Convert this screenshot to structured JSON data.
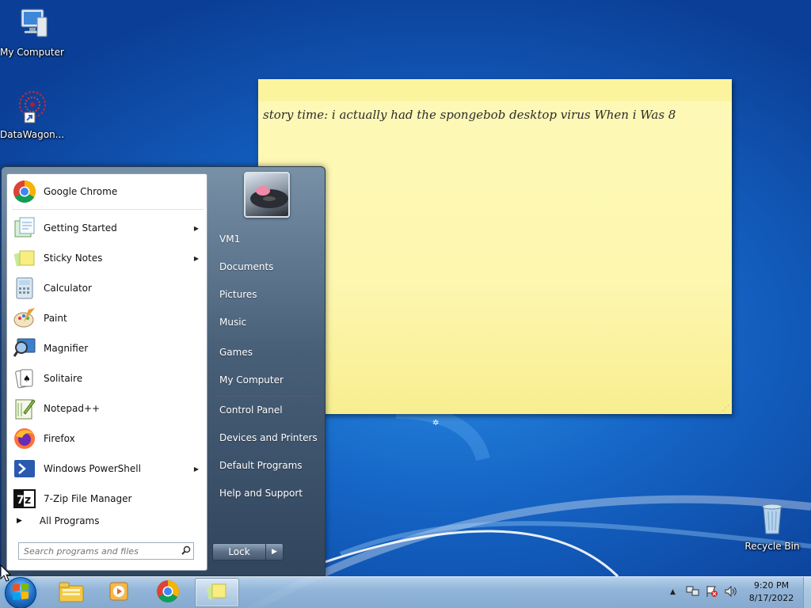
{
  "desktop": {
    "icons": [
      {
        "label": "My Computer",
        "icon": "computer-icon"
      },
      {
        "label": "DataWagon...",
        "icon": "datawagon-shortcut-icon"
      },
      {
        "label": "Recycle Bin",
        "icon": "recycle-bin-icon"
      }
    ]
  },
  "sticky_note": {
    "text": "story time: i actually had the spongebob desktop virus When i Was 8",
    "color": "#fdf8b6"
  },
  "start_menu": {
    "programs": [
      {
        "label": "Google Chrome",
        "icon": "chrome-icon",
        "submenu": false
      },
      {
        "label": "Getting Started",
        "icon": "getting-started-icon",
        "submenu": true
      },
      {
        "label": "Sticky Notes",
        "icon": "sticky-notes-icon",
        "submenu": true
      },
      {
        "label": "Calculator",
        "icon": "calculator-icon",
        "submenu": false
      },
      {
        "label": "Paint",
        "icon": "paint-icon",
        "submenu": false
      },
      {
        "label": "Magnifier",
        "icon": "magnifier-icon",
        "submenu": false
      },
      {
        "label": "Solitaire",
        "icon": "solitaire-icon",
        "submenu": false
      },
      {
        "label": "Notepad++",
        "icon": "notepadpp-icon",
        "submenu": false
      },
      {
        "label": "Firefox",
        "icon": "firefox-icon",
        "submenu": false
      },
      {
        "label": "Windows PowerShell",
        "icon": "powershell-icon",
        "submenu": true
      },
      {
        "label": "7-Zip File Manager",
        "icon": "7zip-icon",
        "submenu": false
      }
    ],
    "all_programs_label": "All Programs",
    "search_placeholder": "Search programs and files",
    "right_items": [
      "VM1",
      "Documents",
      "Pictures",
      "Music",
      "Games",
      "My Computer",
      "Control Panel",
      "Devices and Printers",
      "Default Programs",
      "Help and Support"
    ],
    "lock_label": "Lock"
  },
  "taskbar": {
    "pinned": [
      {
        "name": "explorer-icon"
      },
      {
        "name": "media-player-icon"
      },
      {
        "name": "chrome-icon"
      },
      {
        "name": "sticky-notes-icon",
        "active": true
      }
    ],
    "clock": {
      "time": "9:20 PM",
      "date": "8/17/2022"
    }
  }
}
